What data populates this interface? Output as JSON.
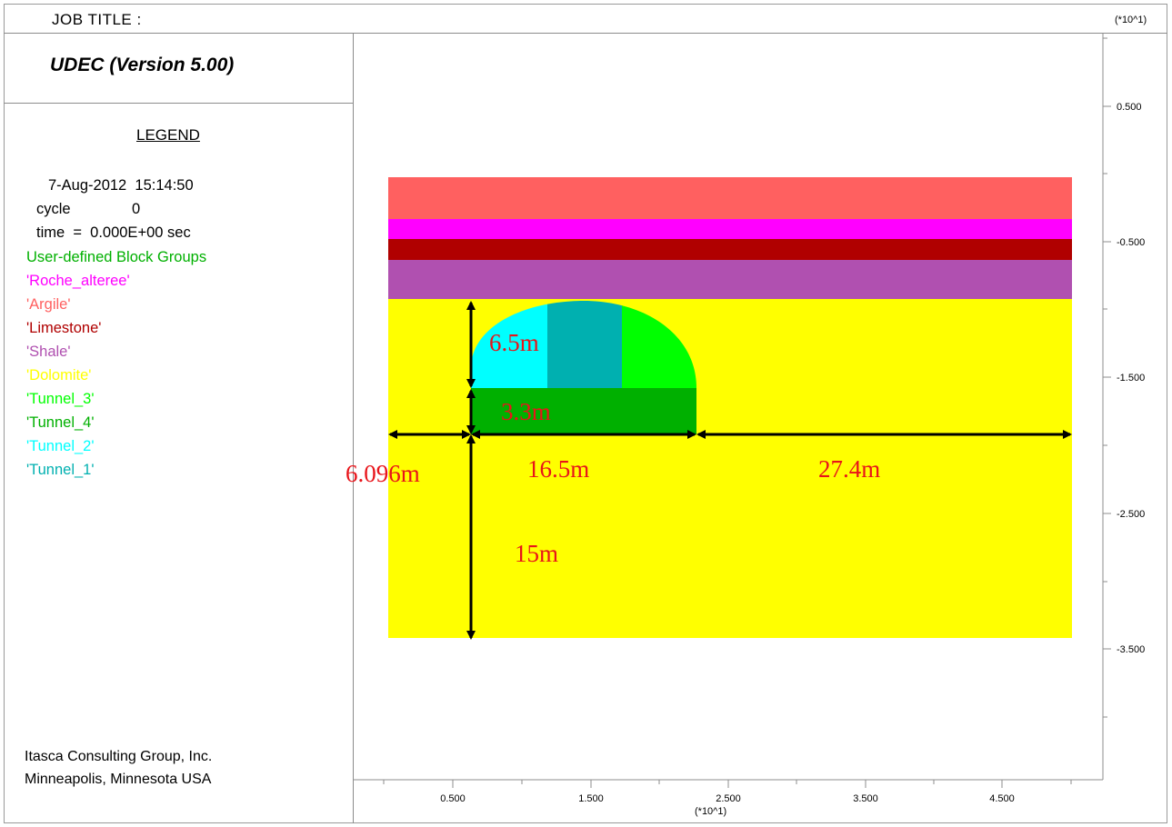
{
  "header": {
    "job_title": "JOB TITLE :",
    "exponent_top": "(*10^1)",
    "exponent_bottom": "(*10^1)"
  },
  "sidebar": {
    "app_title": "UDEC (Version 5.00)",
    "legend_heading": "LEGEND",
    "timestamp": "7-Aug-2012  15:14:50",
    "cycle_label": "cycle",
    "cycle_value": "0",
    "time_line": "time  =  0.000E+00 sec",
    "groups_heading": "User-defined Block Groups",
    "groups": [
      {
        "label": "'Roche_alteree'",
        "color": "#ff00ff"
      },
      {
        "label": "'Argile'",
        "color": "#ff6060"
      },
      {
        "label": "'Limestone'",
        "color": "#b00000"
      },
      {
        "label": "'Shale'",
        "color": "#b050b0"
      },
      {
        "label": "'Dolomite'",
        "color": "#ffff00"
      },
      {
        "label": "'Tunnel_3'",
        "color": "#00ff00"
      },
      {
        "label": "'Tunnel_4'",
        "color": "#00b000"
      },
      {
        "label": "'Tunnel_2'",
        "color": "#00ffff"
      },
      {
        "label": "'Tunnel_1'",
        "color": "#00b0b0"
      }
    ],
    "groups_heading_color": "#00b000",
    "footer_company": "Itasca Consulting Group, Inc.",
    "footer_location": "Minneapolis, Minnesota  USA"
  },
  "axes": {
    "x_ticks": [
      "0.500",
      "1.500",
      "2.500",
      "3.500",
      "4.500"
    ],
    "y_ticks": [
      "0.500",
      "-0.500",
      "-1.500",
      "-2.500",
      "-3.500"
    ]
  },
  "dimensions": {
    "tunnel_arch_height": "6.5m",
    "tunnel_bench_height": "3.3m",
    "left_offset": "6.096m",
    "tunnel_width": "16.5m",
    "right_width": "27.4m",
    "depth_below": "15m"
  },
  "colors": {
    "argile": "#ff6060",
    "roche_alteree": "#ff00ff",
    "limestone": "#b00000",
    "shale": "#b050b0",
    "dolomite": "#ffff00",
    "tunnel_1": "#00b0b0",
    "tunnel_2": "#00ffff",
    "tunnel_3": "#00ff00",
    "tunnel_4": "#00b000",
    "dim_text": "#e8141a"
  }
}
